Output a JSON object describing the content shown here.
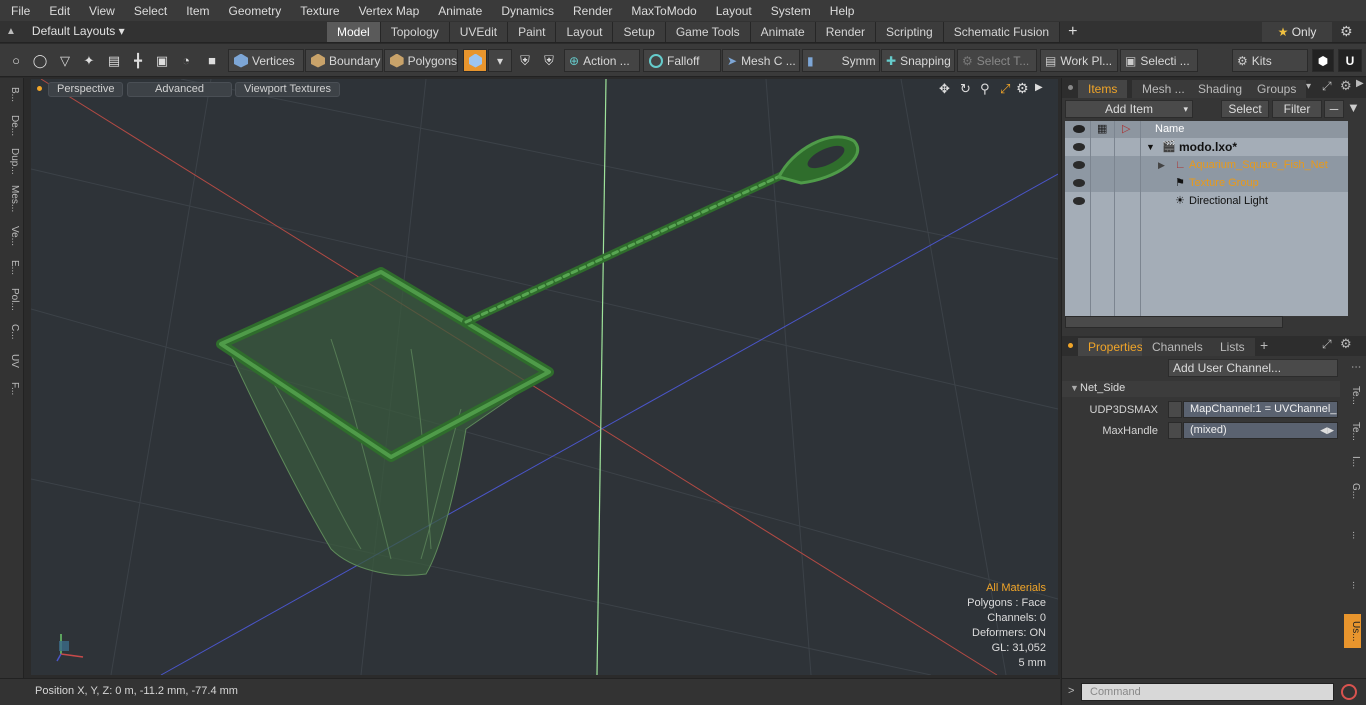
{
  "menu": [
    "File",
    "Edit",
    "View",
    "Select",
    "Item",
    "Geometry",
    "Texture",
    "Vertex Map",
    "Animate",
    "Dynamics",
    "Render",
    "MaxToModo",
    "Layout",
    "System",
    "Help"
  ],
  "layout": {
    "default_layouts": "Default Layouts",
    "tabs": [
      "Model",
      "Topology",
      "UVEdit",
      "Paint",
      "Layout",
      "Setup",
      "Game Tools",
      "Animate",
      "Render",
      "Scripting",
      "Schematic Fusion"
    ],
    "active_tab": "Model",
    "only_label": "Only"
  },
  "toolbar": {
    "vertices": "Vertices",
    "boundary": "Boundary",
    "polygons": "Polygons",
    "action": "Action ...",
    "falloff": "Falloff",
    "mesh_c": "Mesh C ...",
    "symm": "Symm ...",
    "snapping": "Snapping",
    "select_t": "Select T...",
    "work_pl": "Work Pl...",
    "selecti": "Selecti ...",
    "kits": "Kits"
  },
  "left_strip": [
    "B...",
    "De...",
    "Dup...",
    "Mes...",
    "Ve...",
    "E...",
    "Pol...",
    "C...",
    "UV",
    "F..."
  ],
  "viewport": {
    "perspective": "Perspective",
    "advanced": "Advanced",
    "viewport_textures": "Viewport Textures",
    "stats": {
      "all_materials": "All Materials",
      "polygons": "Polygons : Face",
      "channels": "Channels: 0",
      "deformers": "Deformers: ON",
      "gl": "GL: 31,052",
      "scale": "5 mm"
    }
  },
  "status": {
    "position": "Position X, Y, Z:   0 m, -11.2 mm, -77.4 mm"
  },
  "items_panel": {
    "tabs": [
      "Items",
      "Mesh ...",
      "Shading",
      "Groups"
    ],
    "active_tab": "Items",
    "add_item": "Add Item",
    "select": "Select",
    "filter": "Filter",
    "name_header": "Name",
    "rows": [
      "modo.lxo*",
      "Aquarium_Square_Fish_Net",
      "Texture Group",
      "Directional Light"
    ]
  },
  "properties_panel": {
    "tabs": [
      "Properties",
      "Channels",
      "Lists"
    ],
    "active_tab": "Properties",
    "add_user_channel": "Add User Channel...",
    "group": "Net_Side",
    "udp_label": "UDP3DSMAX",
    "udp_value": "MapChannel:1 = UVChannel_",
    "maxhandle_label": "MaxHandle",
    "maxhandle_value": "(mixed)",
    "side_tabs": [
      "Te...",
      "Te...",
      "I...",
      "G...",
      "...",
      "...",
      "Us..."
    ]
  },
  "command": {
    "placeholder": "Command"
  },
  "colors": {
    "accent": "#f1a528",
    "net_green": "#3f8a3a",
    "viewport_bg": "#2e3338"
  }
}
